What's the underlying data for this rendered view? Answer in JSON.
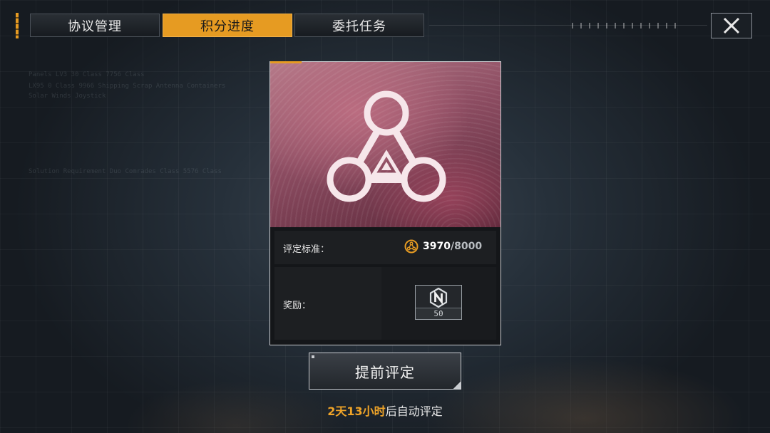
{
  "tabs": [
    {
      "label": "协议管理",
      "active": false
    },
    {
      "label": "积分进度",
      "active": true
    },
    {
      "label": "委托任务",
      "active": false
    }
  ],
  "close_icon": "close-icon",
  "background_text": [
    "Panels LV3 30 Class 7756 Class",
    "LX95 0 Class 9966 Shipping Scrap Antenna Containers",
    "Solar Winds Joystick",
    "Solution Requirement Duo Comrades Class 5576 Class"
  ],
  "card": {
    "emblem_icon": "triangle-network-emblem-icon",
    "criteria_label": "评定标准：",
    "score_icon": "triangle-points-icon",
    "score_current": "3970",
    "score_separator": "/",
    "score_max": "8000",
    "reward_label": "奖励：",
    "reward": {
      "icon": "n-hexagon-token-icon",
      "count": "50"
    }
  },
  "eval_button": {
    "label": "提前评定"
  },
  "timer": {
    "highlight": "2天13小时",
    "suffix": "后自动评定"
  },
  "colors": {
    "accent": "#e69b22",
    "highlight": "#f0a428",
    "card_art": "#8d4d62"
  }
}
